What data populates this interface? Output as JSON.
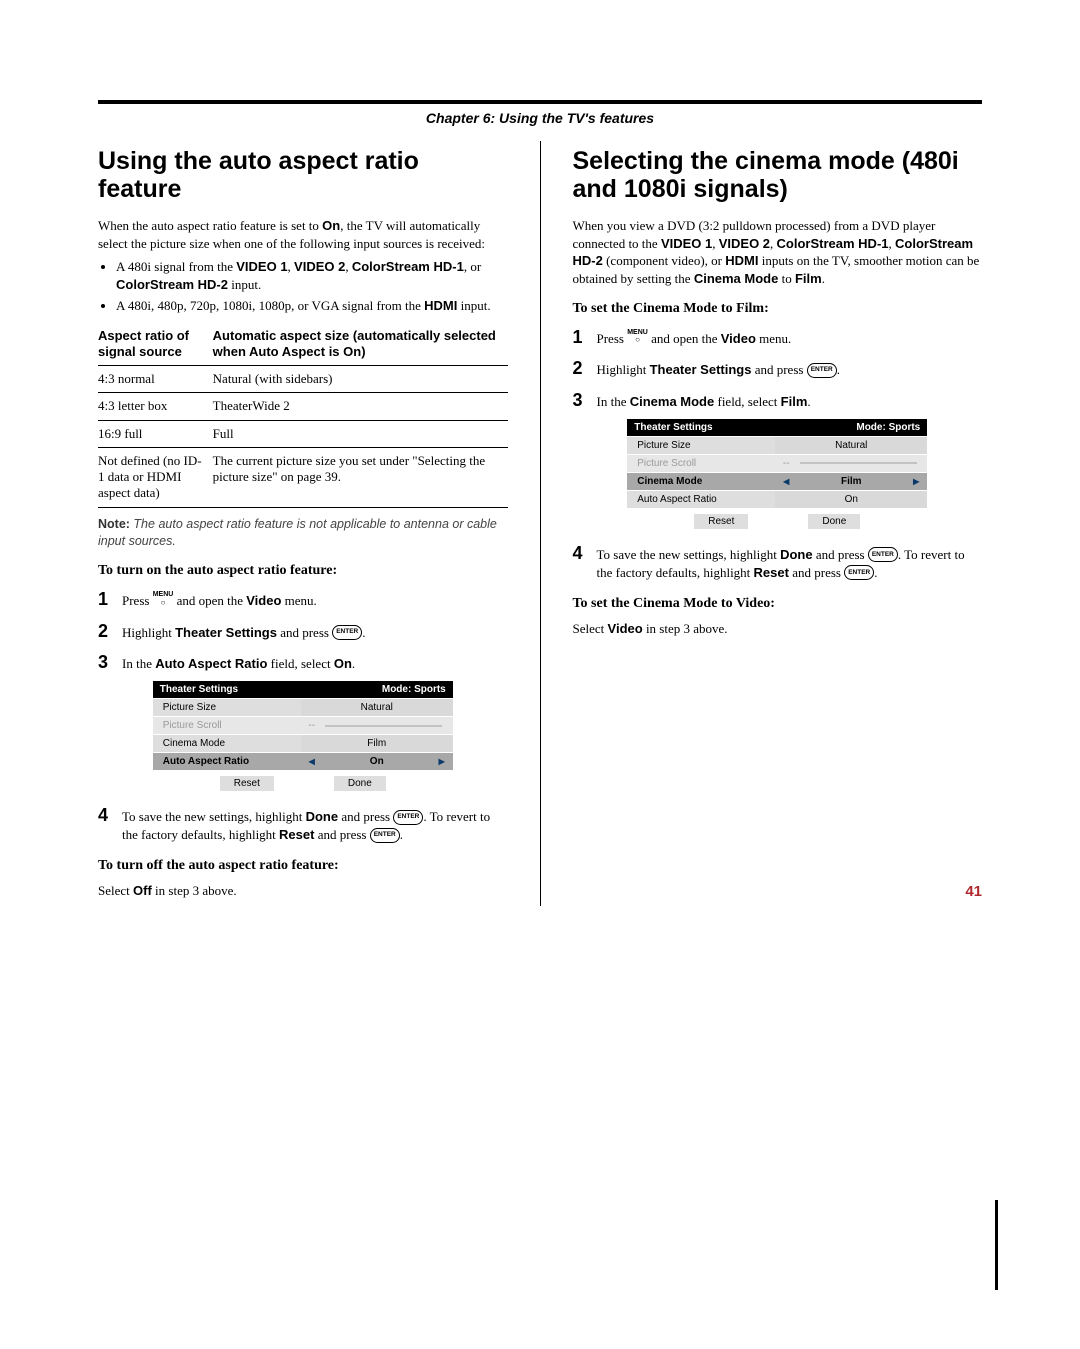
{
  "chapter": "Chapter 6: Using the TV's features",
  "left": {
    "title": "Using the auto aspect ratio feature",
    "intro": "When the auto aspect ratio feature is set to On, the TV will automatically select the picture size when one of the following input sources is received:",
    "bullets": [
      "A 480i signal from the VIDEO 1, VIDEO 2, ColorStream HD-1, or ColorStream HD-2 input.",
      "A 480i, 480p, 720p, 1080i, 1080p, or VGA signal from the HDMI input."
    ],
    "table": {
      "h1": "Aspect ratio of signal source",
      "h2": "Automatic aspect size (automatically selected when Auto Aspect is On)",
      "rows": [
        [
          "4:3 normal",
          "Natural (with sidebars)"
        ],
        [
          "4:3 letter box",
          "TheaterWide 2"
        ],
        [
          "16:9 full",
          "Full"
        ],
        [
          "Not defined (no ID-1 data or HDMI aspect data)",
          "The current picture size you set under \"Selecting the picture size\" on page 39."
        ]
      ]
    },
    "note_label": "Note:",
    "note": " The auto aspect ratio feature is not applicable to antenna or cable input sources.",
    "sub1": "To turn on the auto aspect ratio feature:",
    "steps1": [
      "Press MENU and open the Video menu.",
      "Highlight Theater Settings and press ENTER.",
      "In the Auto Aspect Ratio field, select On."
    ],
    "menu": {
      "title": "Theater Settings",
      "mode": "Mode: Sports",
      "rows": [
        {
          "label": "Picture Size",
          "value": "Natural",
          "sel": false,
          "arrows": false
        },
        {
          "label": "Picture Scroll",
          "value": "--",
          "sel": false,
          "muted": true,
          "slider": true
        },
        {
          "label": "Cinema Mode",
          "value": "Film",
          "sel": false,
          "arrows": false
        },
        {
          "label": "Auto Aspect Ratio",
          "value": "On",
          "sel": true,
          "arrows": true
        }
      ],
      "reset": "Reset",
      "done": "Done"
    },
    "step4": "To save the new settings, highlight Done and press ENTER. To revert to the factory defaults, highlight Reset and press ENTER.",
    "sub2": "To turn off the auto aspect ratio feature:",
    "sub2_body": "Select Off in step 3 above."
  },
  "right": {
    "title": "Selecting the cinema mode (480i and 1080i signals)",
    "intro": "When you view a DVD (3:2 pulldown processed) from a DVD player connected to the VIDEO 1, VIDEO 2, ColorStream HD-1, ColorStream HD-2 (component video), or HDMI inputs on the TV, smoother motion can be obtained by setting the Cinema Mode to Film.",
    "sub1": "To set the Cinema Mode to Film:",
    "steps1": [
      "Press MENU and open the Video menu.",
      "Highlight Theater Settings and press ENTER.",
      "In the Cinema Mode field, select Film."
    ],
    "menu": {
      "title": "Theater Settings",
      "mode": "Mode: Sports",
      "rows": [
        {
          "label": "Picture Size",
          "value": "Natural",
          "sel": false,
          "arrows": false
        },
        {
          "label": "Picture Scroll",
          "value": "--",
          "sel": false,
          "muted": true,
          "slider": true
        },
        {
          "label": "Cinema Mode",
          "value": "Film",
          "sel": true,
          "arrows": true
        },
        {
          "label": "Auto Aspect Ratio",
          "value": "On",
          "sel": false,
          "arrows": false
        }
      ],
      "reset": "Reset",
      "done": "Done"
    },
    "step4": "To save the new settings, highlight Done and press ENTER. To revert to the factory defaults, highlight Reset and press ENTER.",
    "sub2": "To set the Cinema Mode to Video:",
    "sub2_body": "Select Video in step 3 above."
  },
  "page_number": "41"
}
